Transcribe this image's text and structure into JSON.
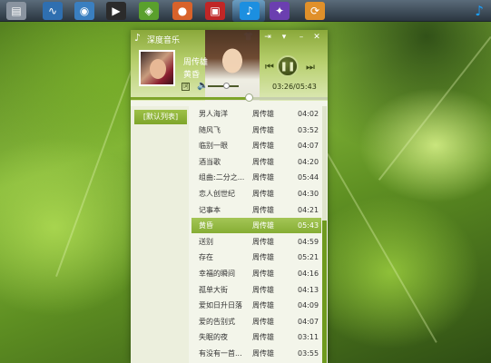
{
  "colors": {
    "accent": "#7ea52a",
    "header": "#b7cf6d",
    "list_bg": "#f3f5ea"
  },
  "dock": {
    "items": [
      {
        "icon": "drive-icon",
        "glyph": "▤",
        "color": "#8a94a0"
      },
      {
        "icon": "system-monitor-icon",
        "glyph": "∿",
        "color": "#2f6fb0"
      },
      {
        "icon": "image-viewer-icon",
        "glyph": "◉",
        "color": "#3a7fc0"
      },
      {
        "icon": "video-player-icon",
        "glyph": "▶",
        "color": "#2b2b2b"
      },
      {
        "icon": "nvidia-icon",
        "glyph": "◈",
        "color": "#5aa02c"
      },
      {
        "icon": "firefox-icon",
        "glyph": "●",
        "color": "#d8622a"
      },
      {
        "icon": "photo-app-icon",
        "glyph": "▣",
        "color": "#c02626"
      },
      {
        "icon": "music-player-icon",
        "glyph": "♪",
        "color": "#1c8fe0"
      },
      {
        "icon": "emesene-icon",
        "glyph": "✦",
        "color": "#6b3fb0"
      },
      {
        "icon": "updater-icon",
        "glyph": "⟳",
        "color": "#e0902a"
      }
    ],
    "corner_glyph": "♪"
  },
  "player": {
    "app_title": "深度音乐",
    "logo_glyph": "♪",
    "title_buttons": [
      "👕",
      "⇥",
      "▾",
      "–",
      "✕"
    ],
    "artist": "周传雄",
    "title": "黄昏",
    "lyric_label": "词",
    "volume_glyph": "🔈",
    "prev_glyph": "⏮",
    "play_glyph": "❚❚",
    "next_glyph": "⏭",
    "time": "03:26/05:43",
    "progress": 0.6,
    "playlist_tab": "[默认列表]"
  },
  "songs": [
    {
      "title": "男人海洋",
      "artist": "周传雄",
      "duration": "04:02"
    },
    {
      "title": "随风飞",
      "artist": "周传雄",
      "duration": "03:52"
    },
    {
      "title": "临别一眼",
      "artist": "周传雄",
      "duration": "04:07"
    },
    {
      "title": "酒当歌",
      "artist": "周传雄",
      "duration": "04:20"
    },
    {
      "title": "组曲:二分之...",
      "artist": "周传雄",
      "duration": "05:44"
    },
    {
      "title": "恋人创世纪",
      "artist": "周传雄",
      "duration": "04:30"
    },
    {
      "title": "记事本",
      "artist": "周传雄",
      "duration": "04:21"
    },
    {
      "title": "黄昏",
      "artist": "周传雄",
      "duration": "05:43",
      "active": true
    },
    {
      "title": "送别",
      "artist": "周传雄",
      "duration": "04:59"
    },
    {
      "title": "存在",
      "artist": "周传雄",
      "duration": "05:21"
    },
    {
      "title": "幸福的瞬间",
      "artist": "周传雄",
      "duration": "04:16"
    },
    {
      "title": "孤单大街",
      "artist": "周传雄",
      "duration": "04:13"
    },
    {
      "title": "爱如日升日落",
      "artist": "周传雄",
      "duration": "04:09"
    },
    {
      "title": "爱的告别式",
      "artist": "周传雄",
      "duration": "04:07"
    },
    {
      "title": "失眠的夜",
      "artist": "周传雄",
      "duration": "03:11"
    },
    {
      "title": "有没有一首...",
      "artist": "周传雄",
      "duration": "03:55"
    }
  ]
}
